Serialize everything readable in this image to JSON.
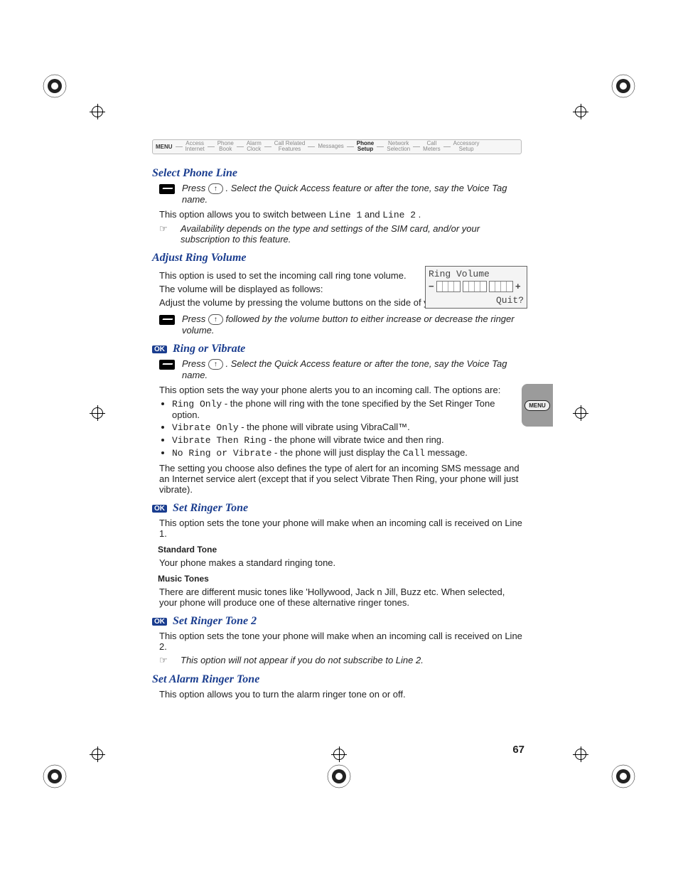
{
  "breadcrumb": {
    "menu": "MENU",
    "items": [
      "Access\nInternet",
      "Phone\nBook",
      "Alarm\nClock",
      "Call Related\nFeatures",
      "Messages",
      "Phone\nSetup",
      "Network\nSelection",
      "Call\nMeters",
      "Accessory\nSetup"
    ],
    "active_index": 5
  },
  "sections": {
    "select_phone_line": {
      "title": "Select Phone Line",
      "tip_prefix": "Press ",
      "tip_key": "↑",
      "tip_rest": ". Select the Quick Access feature or after the tone, say the Voice Tag name.",
      "body_pre": "This option allows you to switch between ",
      "line1": "Line 1",
      "body_mid": " and ",
      "line2": "Line 2",
      "body_post": ".",
      "note": "Availability depends on the type and settings of the SIM card, and/or your subscription to this feature."
    },
    "adjust_ring_volume": {
      "title": "Adjust Ring Volume",
      "p1": "This option is used to set the incoming call ring tone volume.",
      "p2": "The volume will be displayed as follows:",
      "p3": "Adjust the volume by pressing the volume buttons on the side of your phone.",
      "tip_prefix": "Press ",
      "tip_key": "↑",
      "tip_rest": " followed by the volume button to either increase or decrease the ringer volume.",
      "lcd_title": "Ring Volume",
      "lcd_quit": "Quit?"
    },
    "ring_or_vibrate": {
      "ok": "OK",
      "title": "Ring or Vibrate",
      "tip_prefix": "Press ",
      "tip_key": "↑",
      "tip_rest": ". Select the Quick Access feature or after the tone, say the Voice Tag name.",
      "intro": "This option sets the way your phone alerts you to an incoming call. The options are:",
      "opts": [
        {
          "name": "Ring Only",
          "desc": " - the phone will ring with the tone specified by the Set Ringer Tone option."
        },
        {
          "name": "Vibrate Only",
          "desc": " - the phone will vibrate using VibraCall™."
        },
        {
          "name": "Vibrate Then Ring",
          "desc": " - the phone will vibrate twice and then ring."
        },
        {
          "name": "No Ring or Vibrate",
          "desc_pre": " - the phone will just display the ",
          "call": "Call",
          "desc_post": " message."
        }
      ],
      "outro": "The setting you choose also defines the type of alert for an incoming SMS message and an Internet service alert (except that if you select Vibrate Then Ring, your phone will just vibrate)."
    },
    "set_ringer_tone": {
      "ok": "OK",
      "title": "Set Ringer Tone",
      "p1": "This option sets the tone your phone will make when an incoming call is received on Line 1.",
      "sub1": "Standard Tone",
      "sub1_body": "Your phone makes a standard ringing tone.",
      "sub2": "Music Tones",
      "sub2_body": "There are different music tones like 'Hollywood, Jack n Jill, Buzz etc. When selected, your phone will produce one of these alternative ringer tones."
    },
    "set_ringer_tone_2": {
      "ok": "OK",
      "title": "Set Ringer Tone 2",
      "p1": "This option sets the tone your phone will make when an incoming call is received on Line 2.",
      "note": "This option will not appear if you do not subscribe to Line 2."
    },
    "set_alarm_ringer_tone": {
      "title": "Set Alarm Ringer Tone",
      "p1": "This option allows you to turn the alarm ringer tone on or off."
    }
  },
  "side_tab": "MENU",
  "page_number": "67",
  "note_icon": "☞"
}
